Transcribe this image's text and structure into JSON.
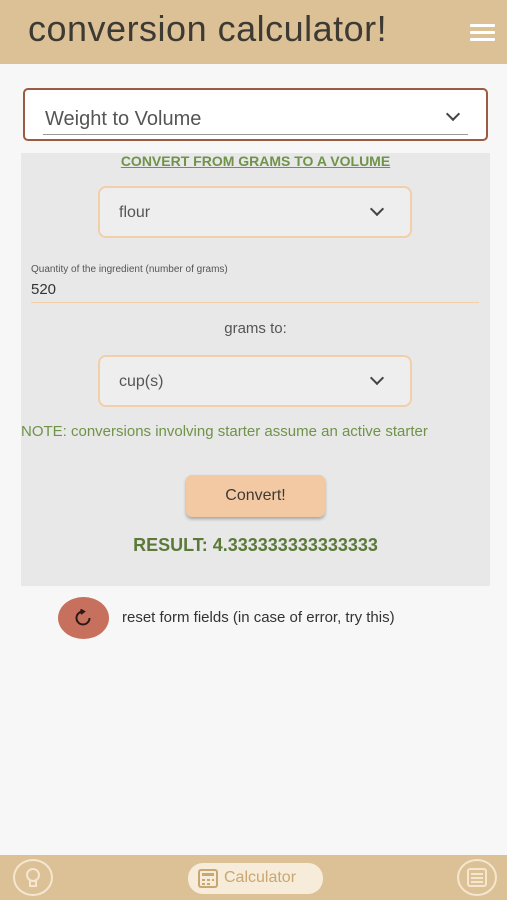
{
  "header": {
    "title": "conversion calculator!",
    "menu_icon": "hamburger-menu-icon"
  },
  "mode_select": {
    "selected": "Weight to Volume",
    "icon": "chevron-down-icon"
  },
  "panel": {
    "heading": "CONVERT FROM GRAMS TO A VOLUME",
    "ingredient_select": {
      "selected": "flour"
    },
    "quantity": {
      "label": "Quantity of the ingredient (number of grams)",
      "value": "520"
    },
    "grams_to_label": "grams to:",
    "unit_select": {
      "selected": "cup(s)"
    },
    "note": "NOTE: conversions involving starter assume an active starter",
    "convert_label": "Convert!",
    "result": "RESULT: 4.333333333333333"
  },
  "reset": {
    "icon": "reset-icon",
    "label": "reset form fields (in case of error, try this)"
  },
  "bottom_nav": {
    "left_icon": "lightbulb-icon",
    "center_label": "Calculator",
    "center_icon": "calculator-icon",
    "right_icon": "list-icon"
  },
  "colors": {
    "bar": "#dcc197",
    "accent_green": "#6f9348",
    "select_border": "#f1cfa8",
    "reset_button": "#c8705e",
    "convert_button": "#f3c9a4"
  }
}
